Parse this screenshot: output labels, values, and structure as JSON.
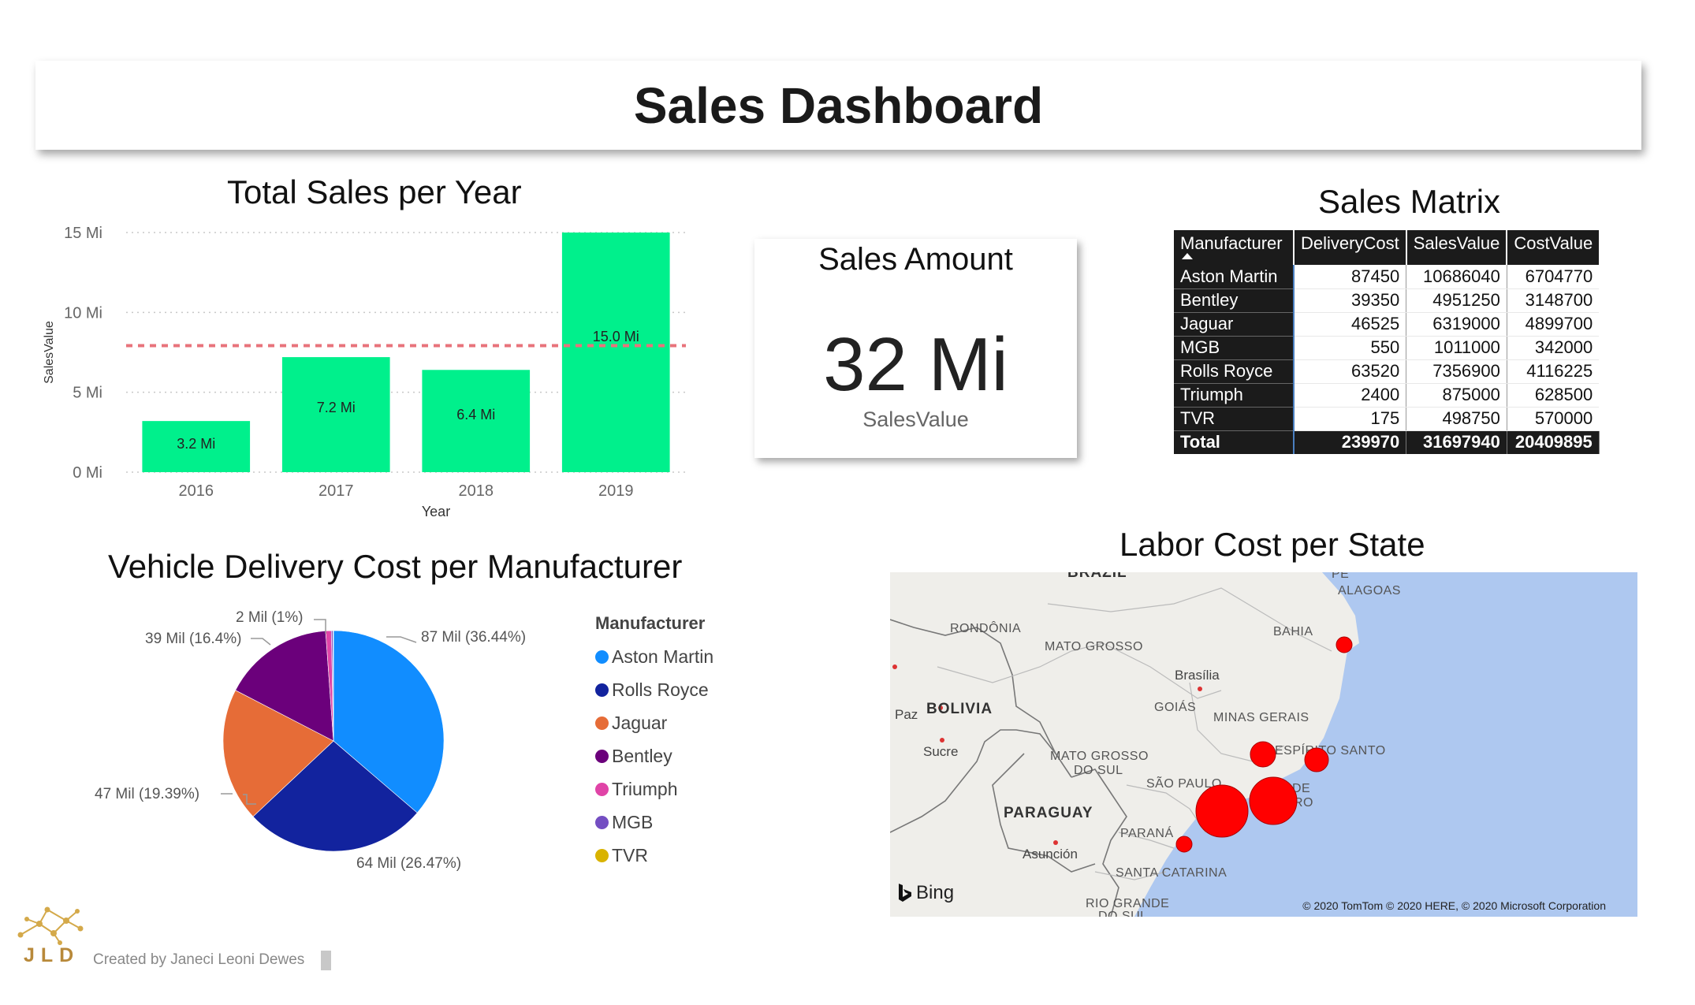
{
  "header": {
    "title": "Sales Dashboard"
  },
  "bar_section": {
    "title": "Total Sales per Year"
  },
  "kpi": {
    "title": "Sales Amount",
    "value": "32 Mi",
    "label": "SalesValue"
  },
  "matrix": {
    "title": "Sales Matrix",
    "columns": [
      "Manufacturer",
      "DeliveryCost",
      "SalesValue",
      "CostValue"
    ],
    "rows": [
      [
        "Aston Martin",
        "87450",
        "10686040",
        "6704770"
      ],
      [
        "Bentley",
        "39350",
        "4951250",
        "3148700"
      ],
      [
        "Jaguar",
        "46525",
        "6319000",
        "4899700"
      ],
      [
        "MGB",
        "550",
        "1011000",
        "342000"
      ],
      [
        "Rolls Royce",
        "63520",
        "7356900",
        "4116225"
      ],
      [
        "Triumph",
        "2400",
        "875000",
        "628500"
      ],
      [
        "TVR",
        "175",
        "498750",
        "570000"
      ]
    ],
    "total": [
      "Total",
      "239970",
      "31697940",
      "20409895"
    ]
  },
  "pie_section": {
    "title": "Vehicle Delivery Cost per Manufacturer"
  },
  "map_section": {
    "title": "Labor Cost per State",
    "labels": {
      "brazil": "BRAZIL",
      "pe": "PE",
      "alagoas": "ALAGOAS",
      "rondonia": "RONDÔNIA",
      "bahia": "BAHIA",
      "mato_grosso": "MATO GROSSO",
      "brasilia": "Brasília",
      "goias": "GOIÁS",
      "paz": "Paz",
      "bolivia": "BOLIVIA",
      "minas_gerais": "MINAS GERAIS",
      "sucre": "Sucre",
      "ms1": "MATO GROSSO",
      "ms2": "DO SUL",
      "espirito": "ESPÍRITO SANTO",
      "sao_paulo": "SÃO PAULO",
      "de": "DE",
      "ro": "RO",
      "paraguay": "PARAGUAY",
      "parana": "PARANÁ",
      "asuncion": "Asunción",
      "santa_catarina": "SANTA CATARINA",
      "rio_grande": "RIO GRANDE",
      "do_sul2": "DO SUL"
    },
    "bing_text": "Bing",
    "copyright": "© 2020 TomTom © 2020 HERE, © 2020 Microsoft Corporation",
    "bubble_color": "#ff0000"
  },
  "footer": {
    "credit": "Created by Janeci Leoni Dewes",
    "logo_text": "JLD"
  },
  "chart_data": [
    {
      "type": "bar",
      "title": "Total Sales per Year",
      "xlabel": "Year",
      "ylabel": "SalesValue",
      "categories": [
        "2016",
        "2017",
        "2018",
        "2019"
      ],
      "values": [
        3.2,
        7.2,
        6.4,
        15.0
      ],
      "data_labels": [
        "3.2 Mi",
        "7.2 Mi",
        "6.4 Mi",
        "15.0 Mi"
      ],
      "yticks": [
        0,
        5,
        10,
        15
      ],
      "ytick_labels": [
        "0 Mi",
        "5 Mi",
        "10 Mi",
        "15 Mi"
      ],
      "ylim": [
        0,
        15
      ],
      "average_line": 7.92,
      "bar_color": "#00f08c",
      "average_line_color": "#e8737b",
      "grid": true
    },
    {
      "type": "pie",
      "title": "Vehicle Delivery Cost per Manufacturer",
      "legend_title": "Manufacturer",
      "legend_position": "right",
      "slices": [
        {
          "name": "Aston Martin",
          "value": 87,
          "percent": 36.44,
          "label": "87 Mil (36.44%)",
          "color": "#118dff"
        },
        {
          "name": "Rolls Royce",
          "value": 64,
          "percent": 26.47,
          "label": "64 Mil (26.47%)",
          "color": "#12239e"
        },
        {
          "name": "Jaguar",
          "value": 47,
          "percent": 19.39,
          "label": "47 Mil (19.39%)",
          "color": "#e66c37"
        },
        {
          "name": "Bentley",
          "value": 39,
          "percent": 16.4,
          "label": "39 Mil (16.4%)",
          "color": "#6b007b"
        },
        {
          "name": "Triumph",
          "value": 2,
          "percent": 1.0,
          "label": "2 Mil (1%)",
          "color": "#e044a7"
        },
        {
          "name": "MGB",
          "value": 0.55,
          "percent": 0.23,
          "label": "",
          "color": "#744ec2"
        },
        {
          "name": "TVR",
          "value": 0.175,
          "percent": 0.07,
          "label": "",
          "color": "#d9b300"
        }
      ]
    }
  ]
}
